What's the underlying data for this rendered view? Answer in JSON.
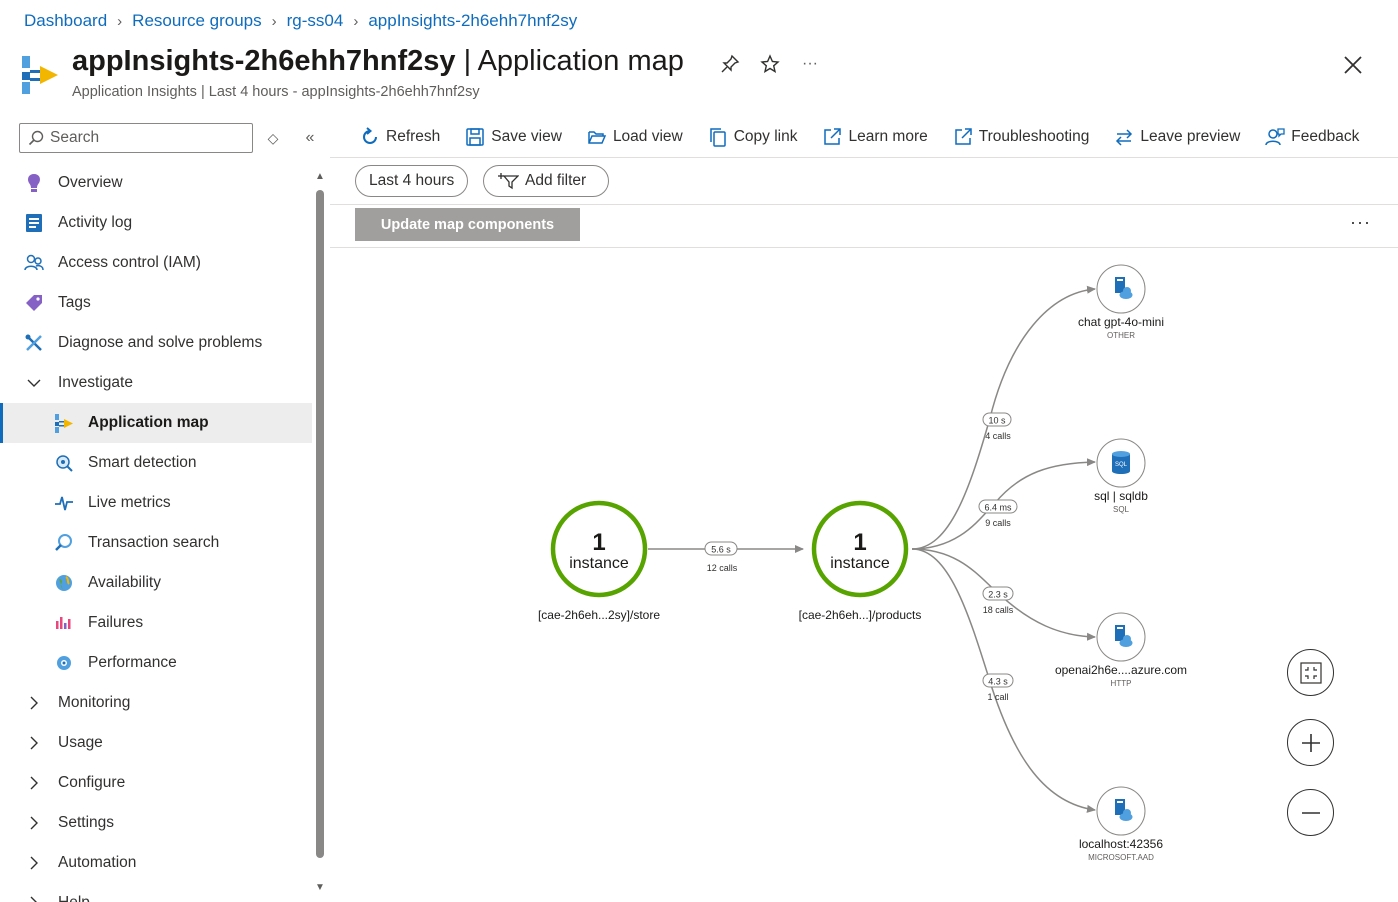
{
  "breadcrumb": [
    "Dashboard",
    "Resource groups",
    "rg-ss04",
    "appInsights-2h6ehh7hnf2sy"
  ],
  "header": {
    "resource_name": "appInsights-2h6ehh7hnf2sy",
    "page_name": "| Application map",
    "subtitle": "Application Insights | Last 4 hours - appInsights-2h6ehh7hnf2sy",
    "more": "···"
  },
  "sidebar": {
    "search_placeholder": "Search",
    "items": [
      {
        "label": "Overview",
        "icon": "overview-icon"
      },
      {
        "label": "Activity log",
        "icon": "activity-log-icon"
      },
      {
        "label": "Access control (IAM)",
        "icon": "people-icon"
      },
      {
        "label": "Tags",
        "icon": "tag-icon"
      },
      {
        "label": "Diagnose and solve problems",
        "icon": "wrench-icon"
      },
      {
        "label": "Investigate",
        "icon": "chevron-down-icon"
      },
      {
        "label": "Application map",
        "icon": "app-map-icon"
      },
      {
        "label": "Smart detection",
        "icon": "smart-detection-icon"
      },
      {
        "label": "Live metrics",
        "icon": "pulse-icon"
      },
      {
        "label": "Transaction search",
        "icon": "search-icon"
      },
      {
        "label": "Availability",
        "icon": "globe-icon"
      },
      {
        "label": "Failures",
        "icon": "failures-icon"
      },
      {
        "label": "Performance",
        "icon": "performance-icon"
      },
      {
        "label": "Monitoring",
        "icon": "chevron-right-icon"
      },
      {
        "label": "Usage",
        "icon": "chevron-right-icon"
      },
      {
        "label": "Configure",
        "icon": "chevron-right-icon"
      },
      {
        "label": "Settings",
        "icon": "chevron-right-icon"
      },
      {
        "label": "Automation",
        "icon": "chevron-right-icon"
      },
      {
        "label": "Help",
        "icon": "chevron-right-icon"
      }
    ]
  },
  "toolbar": {
    "refresh": "Refresh",
    "save_view": "Save view",
    "load_view": "Load view",
    "copy_link": "Copy link",
    "learn_more": "Learn more",
    "troubleshooting": "Troubleshooting",
    "leave_preview": "Leave preview",
    "feedback": "Feedback"
  },
  "filters": {
    "time_range": "Last 4 hours",
    "add_filter": "Add filter",
    "update_button": "Update map components",
    "more": "···"
  },
  "map": {
    "nodes": [
      {
        "count": "1",
        "unit": "instance",
        "label": "[cae-2h6eh...2sy]/store"
      },
      {
        "count": "1",
        "unit": "instance",
        "label": "[cae-2h6eh...]/products"
      }
    ],
    "dependencies": [
      {
        "name": "chat gpt-4o-mini",
        "type": "OTHER",
        "duration": "10 s",
        "calls": "4 calls"
      },
      {
        "name": "sql | sqldb",
        "type": "SQL",
        "duration": "6.4 ms",
        "calls": "9 calls"
      },
      {
        "name": "openai2h6e....azure.com",
        "type": "HTTP",
        "duration": "2.3 s",
        "calls": "18 calls"
      },
      {
        "name": "localhost:42356",
        "type": "MICROSOFT.AAD",
        "duration": "4.3 s",
        "calls": "1 call"
      }
    ],
    "main_edge": {
      "duration": "5.6 s",
      "calls": "12 calls"
    },
    "colors": {
      "healthy": "#57a300",
      "edge": "#8a8886",
      "accent": "#0f6cbd"
    }
  }
}
